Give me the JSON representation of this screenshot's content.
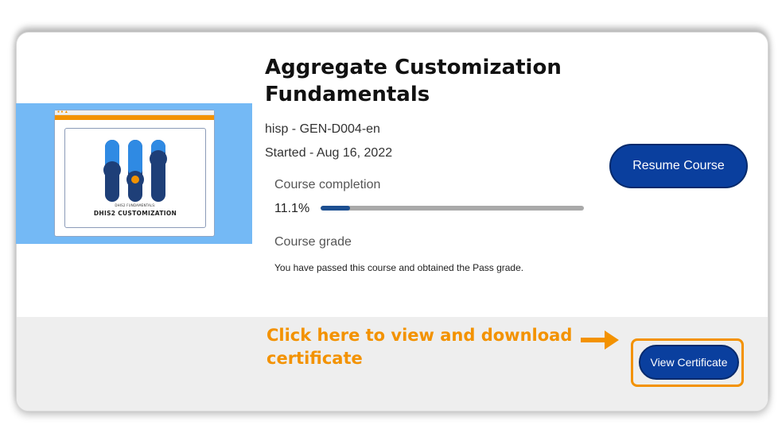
{
  "course": {
    "title_line1": "Aggregate Customization",
    "title_line2": "Fundamentals",
    "org_code": "hisp - GEN-D004-en",
    "started": "Started - Aug 16, 2022",
    "completion_label": "Course completion",
    "completion_percent_text": "11.1%",
    "completion_fraction": 0.111,
    "grade_label": "Course grade",
    "pass_message": "You have passed this course and obtained the Pass grade."
  },
  "thumbnail": {
    "caption_small": "DHIS2 FUNDAMENTALS:",
    "caption_large": "DHIS2 CUSTOMIZATION"
  },
  "actions": {
    "resume_label": "Resume Course",
    "certificate_label": "View Certificate"
  },
  "annotation": {
    "callout_line1": "Click here to view and download",
    "callout_line2": "certificate"
  },
  "colors": {
    "primary_button": "#0a3f9e",
    "accent_orange": "#f39200",
    "progress_fill": "#1d4f91",
    "thumbnail_bg": "#74b9f5"
  }
}
